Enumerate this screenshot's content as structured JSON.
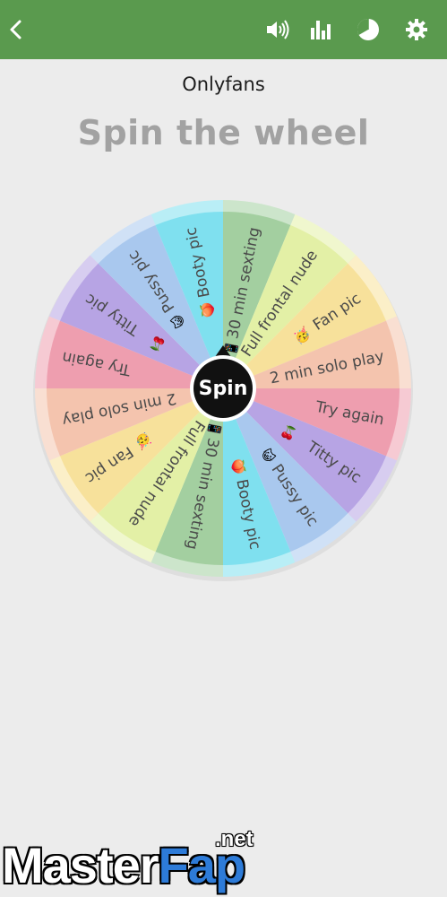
{
  "header": {
    "back_icon": "chevron-left-icon",
    "sound_icon": "speaker-icon",
    "stats_icon": "bar-chart-icon",
    "pie_icon": "pie-chart-icon",
    "settings_icon": "gear-icon",
    "bar_color": "#5a9a4e"
  },
  "list_name": "Onlyfans",
  "title": "Spin the wheel",
  "spin_button": {
    "label": "Spin"
  },
  "wheel": {
    "slices": [
      {
        "label": "30 min sexting",
        "emoji": "📱",
        "color": "#a3cfa0"
      },
      {
        "label": "Full frontal nude",
        "emoji": "",
        "color": "#e3f0a6"
      },
      {
        "label": "Fan pic",
        "emoji": "🥳",
        "color": "#f7e19b"
      },
      {
        "label": "2 min solo play",
        "emoji": "",
        "color": "#f4c4ae"
      },
      {
        "label": "Try again",
        "emoji": "",
        "color": "#ee9eaf"
      },
      {
        "label": "Titty pic",
        "emoji": "🍒",
        "color": "#b7a4e4"
      },
      {
        "label": "Pussy pic",
        "emoji": "😺",
        "color": "#a9c8ee"
      },
      {
        "label": "Booty pic",
        "emoji": "🍑",
        "color": "#7fe0ef"
      },
      {
        "label": "30 min sexting",
        "emoji": "📱",
        "color": "#a3cfa0"
      },
      {
        "label": "Full frontal nude",
        "emoji": "",
        "color": "#e3f0a6"
      },
      {
        "label": "Fan pic",
        "emoji": "🥳",
        "color": "#f7e19b"
      },
      {
        "label": "2 min solo play",
        "emoji": "",
        "color": "#f4c4ae"
      },
      {
        "label": "Try again",
        "emoji": "",
        "color": "#ee9eaf"
      },
      {
        "label": "Titty pic",
        "emoji": "🍒",
        "color": "#b7a4e4"
      },
      {
        "label": "Pussy pic",
        "emoji": "😺",
        "color": "#a9c8ee"
      },
      {
        "label": "Booty pic",
        "emoji": "🍑",
        "color": "#7fe0ef"
      }
    ]
  },
  "watermark": {
    "main": "Master",
    "accent": "Fap",
    "suffix": ".net"
  }
}
